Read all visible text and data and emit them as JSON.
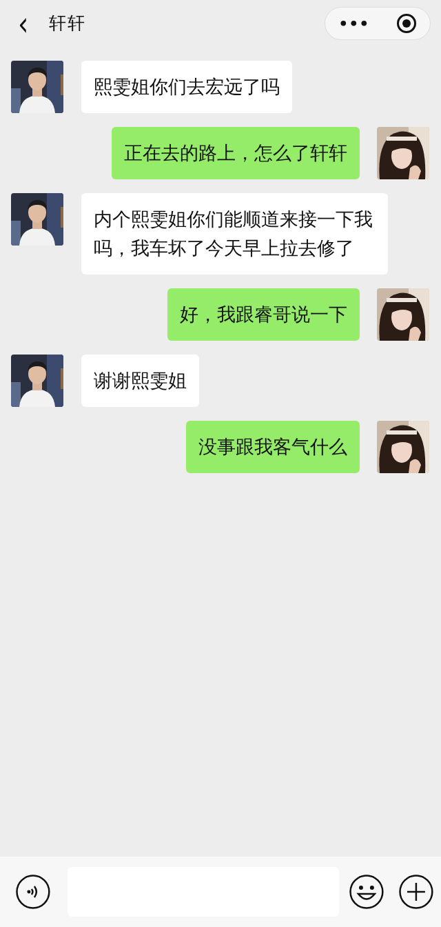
{
  "header": {
    "back": "‹",
    "title": "轩轩",
    "more": "•••"
  },
  "messages": [
    {
      "kind": "received",
      "text": "熙雯姐你们去宏远了吗"
    },
    {
      "kind": "sent",
      "text": "正在去的路上，怎么了轩轩"
    },
    {
      "kind": "received",
      "text": "内个熙雯姐你们能顺道来接一下我吗，我车坏了今天早上拉去修了"
    },
    {
      "kind": "sent",
      "text": "好，我跟睿哥说一下"
    },
    {
      "kind": "received",
      "text": "谢谢熙雯姐"
    },
    {
      "kind": "sent",
      "text": "没事跟我客气什么"
    }
  ]
}
